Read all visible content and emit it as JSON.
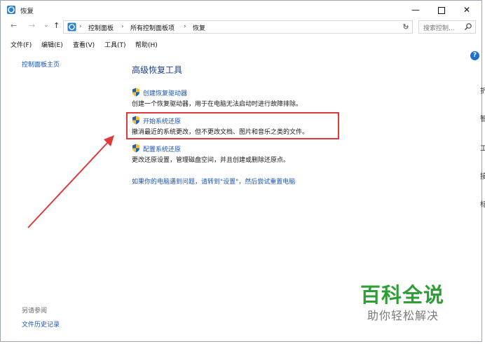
{
  "window": {
    "title": "恢复",
    "minimize": "—",
    "close": "✕"
  },
  "nav": {
    "back": "←",
    "forward": "→",
    "recent": "⌄",
    "up": "↑"
  },
  "address": {
    "crumbs": [
      "控制面板",
      "所有控制面板项",
      "恢复"
    ],
    "separator": "›",
    "dropdown": "⌄",
    "refresh": "↻"
  },
  "search": {
    "placeholder": "搜索控制..."
  },
  "menu": [
    "文件(F)",
    "编辑(E)",
    "查看(V)",
    "工具(T)",
    "帮助(H)"
  ],
  "left_pane": {
    "home_link": "控制面板主页",
    "see_also_label": "另请参阅",
    "file_history_link": "文件历史记录"
  },
  "main": {
    "heading": "高级恢复工具",
    "tasks": [
      {
        "link": "创建恢复驱动器",
        "desc": "创建一个恢复驱动器，用于在电脑无法启动时进行故障排除。"
      },
      {
        "link": "开始系统还原",
        "desc": "撤消最近的系统更改，但不更改文档、图片和音乐之类的文件。"
      },
      {
        "link": "配置系统还原",
        "desc": "更改还原设置，管理磁盘空间，并且创建或删除还原点。"
      }
    ],
    "reset_link": "如果你的电脑遇到问题，请转到\"设置\"，然后尝试重置电脑",
    "help": "?"
  },
  "right_edge": [
    "折",
    "智",
    "工",
    "接",
    "标"
  ],
  "watermark": {
    "main": "百科全说",
    "sub": "助你轻松解决"
  },
  "colors": {
    "link": "#1a52b8",
    "heading": "#1a3c8c",
    "highlight": "#e03a3a",
    "watermark": "#2f9e37"
  }
}
